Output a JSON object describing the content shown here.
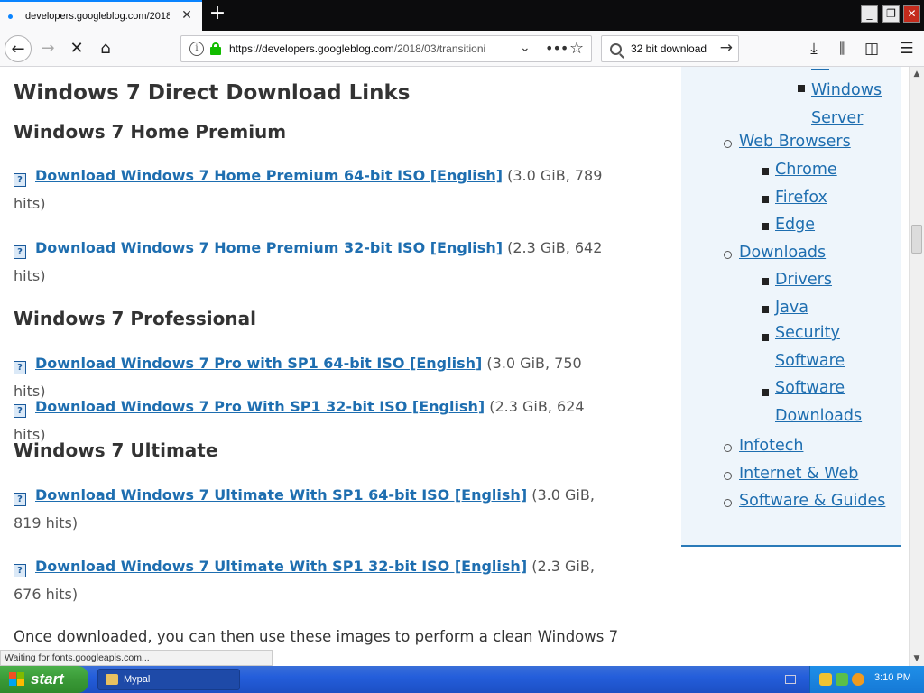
{
  "tab": {
    "title": "developers.googleblog.com/2018/"
  },
  "nav": {
    "url_host": "https://developers.googleblog.com",
    "url_path": "/2018/03/transitioni",
    "search_value": "32 bit download"
  },
  "content": {
    "heading": "Windows 7 Direct Download Links",
    "sections": [
      {
        "title": "Windows 7 Home Premium",
        "items": [
          {
            "link": "Download Windows 7 Home Premium 64-bit ISO [English]",
            "meta": "(3.0 GiB, 789 hits)"
          },
          {
            "link": "Download Windows 7 Home Premium 32-bit ISO [English]",
            "meta": "(2.3 GiB, 642 hits)"
          }
        ]
      },
      {
        "title": "Windows 7 Professional",
        "items": [
          {
            "link": "Download Windows 7 Pro with SP1 64-bit ISO [English]",
            "meta": "(3.0 GiB, 750 hits)"
          },
          {
            "link": "Download Windows 7 Pro With SP1 32-bit ISO [English]",
            "meta": "(2.3 GiB, 624 hits)"
          }
        ]
      },
      {
        "title": "Windows 7 Ultimate",
        "items": [
          {
            "link": "Download Windows 7 Ultimate With SP1 64-bit ISO [English]",
            "meta": "(3.0 GiB, 819 hits)"
          },
          {
            "link": "Download Windows 7 Ultimate With SP1 32-bit ISO [English]",
            "meta": "(2.3 GiB, 676 hits)"
          }
        ]
      }
    ],
    "paragraph": "Once downloaded, you can then use these images to perform a clean Windows 7"
  },
  "sidebar": {
    "items": [
      {
        "label": "Windows Server",
        "level": 2
      },
      {
        "label": "Web Browsers",
        "level": 1
      },
      {
        "label": "Chrome",
        "level": 2
      },
      {
        "label": "Firefox",
        "level": 2
      },
      {
        "label": "Edge",
        "level": 2
      },
      {
        "label": "Downloads",
        "level": 1
      },
      {
        "label": "Drivers",
        "level": 2
      },
      {
        "label": "Java",
        "level": 2
      },
      {
        "label": "Security Software",
        "level": 2
      },
      {
        "label": "Software Downloads",
        "level": 2
      },
      {
        "label": "Infotech",
        "level": 1
      },
      {
        "label": "Internet & Web",
        "level": 1
      },
      {
        "label": "Software & Guides",
        "level": 1
      }
    ]
  },
  "status": {
    "text": "Waiting for fonts.googleapis.com..."
  },
  "taskbar": {
    "start_label": "start",
    "app_label": "Mypal",
    "clock": "3:10 PM"
  },
  "colors": {
    "link": "#1e6eb0",
    "accent": "#0a84ff",
    "lock": "#12bc00",
    "sidebar_bg": "#eef5fb"
  }
}
